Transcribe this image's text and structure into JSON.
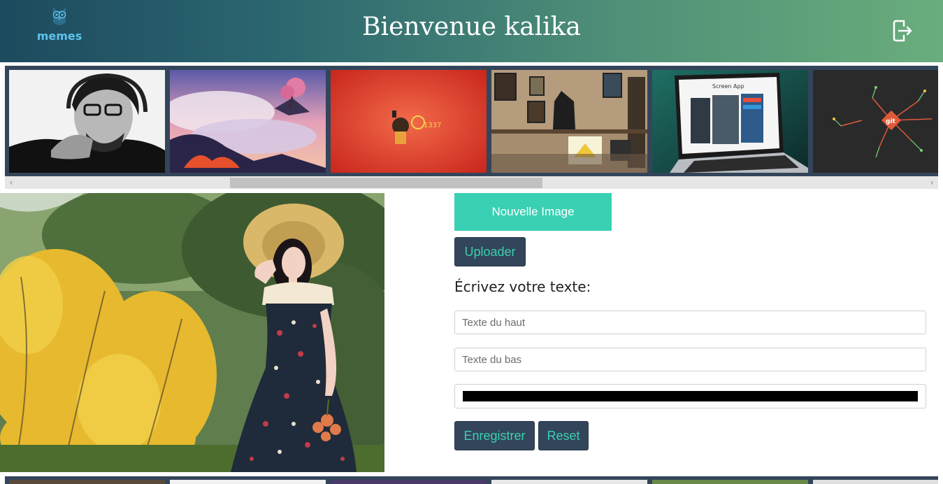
{
  "header": {
    "logo_text": "memes",
    "title": "Bienvenue kalika",
    "logout_icon": "logout-icon"
  },
  "gallery": {
    "thumbnails": [
      {
        "name": "thumb-man-headphones",
        "alt": "man with headphones"
      },
      {
        "name": "thumb-fantasy-landscape",
        "alt": "fantasy landscape"
      },
      {
        "name": "thumb-red-character",
        "alt": "red character"
      },
      {
        "name": "thumb-shop-interior",
        "alt": "shop interior"
      },
      {
        "name": "thumb-laptop-screen-app",
        "alt": "Screen App"
      },
      {
        "name": "thumb-git-logo",
        "alt": "git"
      }
    ],
    "laptop_caption": "Screen App",
    "git_badge": "git"
  },
  "editor": {
    "new_image_label": "Nouvelle Image",
    "upload_label": "Uploader",
    "write_text_label": "Écrivez votre texte:",
    "top_text_placeholder": "Texte du haut",
    "top_text_value": "",
    "bottom_text_placeholder": "Texte du bas",
    "bottom_text_value": "",
    "text_color": "#000000",
    "save_label": "Enregistrer",
    "reset_label": "Reset"
  },
  "colors": {
    "accent": "#3ad0b4",
    "dark_button": "#33455a",
    "header_start": "#1c4a5e",
    "header_end": "#6aad7c"
  }
}
